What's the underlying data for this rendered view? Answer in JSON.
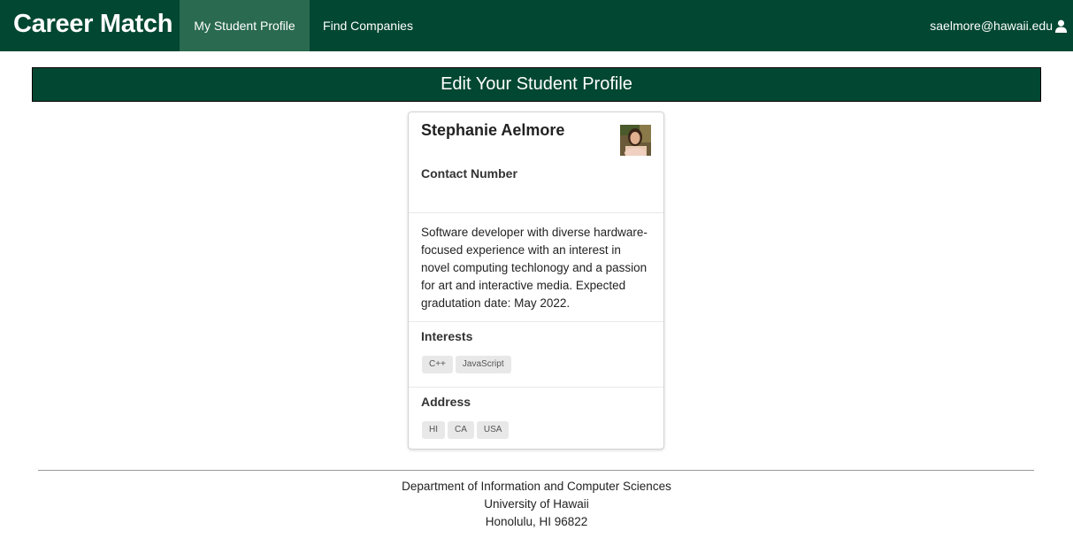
{
  "navbar": {
    "brand": "Career Match",
    "items": [
      {
        "label": "My Student Profile",
        "active": true
      },
      {
        "label": "Find Companies",
        "active": false
      }
    ],
    "user_email": "saelmore@hawaii.edu",
    "user_icon": "user-icon",
    "color": "#024731"
  },
  "banner": {
    "title": "Edit Your Student Profile"
  },
  "profile": {
    "name": "Stephanie Aelmore",
    "avatar": "profile-photo",
    "contact_label": "Contact Number",
    "bio": "Software developer with diverse hardware-focused experience with an interest in novel computing techlonogy and a passion for art and interactive media. Expected gradutation date: May 2022.",
    "interests_label": "Interests",
    "interests": [
      "C++",
      "JavaScript"
    ],
    "address_label": "Address",
    "address": [
      "HI",
      "CA",
      "USA"
    ]
  },
  "footer": {
    "line1": "Department of Information and Computer Sciences",
    "line2": "University of Hawaii",
    "line3": "Honolulu, HI 96822"
  }
}
